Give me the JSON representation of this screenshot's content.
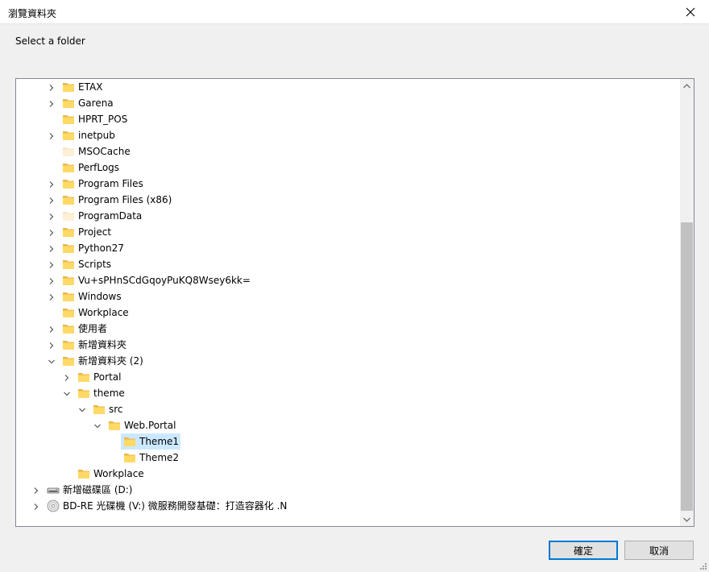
{
  "window": {
    "title": "瀏覽資料夾"
  },
  "prompt": "Select a folder",
  "tree": {
    "items": [
      {
        "label": "ETAX",
        "depth": 1,
        "expander": "collapsed",
        "icon": "folder"
      },
      {
        "label": "Garena",
        "depth": 1,
        "expander": "collapsed",
        "icon": "folder"
      },
      {
        "label": "HPRT_POS",
        "depth": 1,
        "expander": "none",
        "icon": "folder"
      },
      {
        "label": "inetpub",
        "depth": 1,
        "expander": "collapsed",
        "icon": "folder"
      },
      {
        "label": "MSOCache",
        "depth": 1,
        "expander": "none",
        "icon": "folder-hidden"
      },
      {
        "label": "PerfLogs",
        "depth": 1,
        "expander": "none",
        "icon": "folder"
      },
      {
        "label": "Program Files",
        "depth": 1,
        "expander": "collapsed",
        "icon": "folder"
      },
      {
        "label": "Program Files (x86)",
        "depth": 1,
        "expander": "collapsed",
        "icon": "folder"
      },
      {
        "label": "ProgramData",
        "depth": 1,
        "expander": "collapsed",
        "icon": "folder-hidden"
      },
      {
        "label": "Project",
        "depth": 1,
        "expander": "collapsed",
        "icon": "folder"
      },
      {
        "label": "Python27",
        "depth": 1,
        "expander": "collapsed",
        "icon": "folder"
      },
      {
        "label": "Scripts",
        "depth": 1,
        "expander": "collapsed",
        "icon": "folder"
      },
      {
        "label": "Vu+sPHnSCdGqoyPuKQ8Wsey6kk=",
        "depth": 1,
        "expander": "collapsed",
        "icon": "folder"
      },
      {
        "label": "Windows",
        "depth": 1,
        "expander": "collapsed",
        "icon": "folder"
      },
      {
        "label": "Workplace",
        "depth": 1,
        "expander": "none",
        "icon": "folder"
      },
      {
        "label": "使用者",
        "depth": 1,
        "expander": "collapsed",
        "icon": "folder"
      },
      {
        "label": "新增資料夾",
        "depth": 1,
        "expander": "collapsed",
        "icon": "folder"
      },
      {
        "label": "新增資料夾 (2)",
        "depth": 1,
        "expander": "expanded",
        "icon": "folder"
      },
      {
        "label": "Portal",
        "depth": 2,
        "expander": "collapsed",
        "icon": "folder"
      },
      {
        "label": "theme",
        "depth": 2,
        "expander": "expanded",
        "icon": "folder"
      },
      {
        "label": "src",
        "depth": 3,
        "expander": "expanded",
        "icon": "folder"
      },
      {
        "label": "Web.Portal",
        "depth": 4,
        "expander": "expanded",
        "icon": "folder"
      },
      {
        "label": "Theme1",
        "depth": 5,
        "expander": "none",
        "icon": "folder",
        "selected": true
      },
      {
        "label": "Theme2",
        "depth": 5,
        "expander": "none",
        "icon": "folder"
      },
      {
        "label": "Workplace",
        "depth": 2,
        "expander": "none",
        "icon": "folder"
      },
      {
        "label": "新增磁碟區 (D:)",
        "depth": 0,
        "expander": "collapsed",
        "icon": "drive"
      },
      {
        "label": "BD-RE 光碟機 (V:) 微服務開發基礎：打造容器化 .N",
        "depth": 0,
        "expander": "collapsed",
        "icon": "optical-drive"
      }
    ]
  },
  "buttons": {
    "ok": "確定",
    "cancel": "取消"
  },
  "colors": {
    "folder": "#ffd966",
    "folder_dark": "#e8b84a",
    "selection": "#cce8ff",
    "default_border": "#0078d7"
  }
}
